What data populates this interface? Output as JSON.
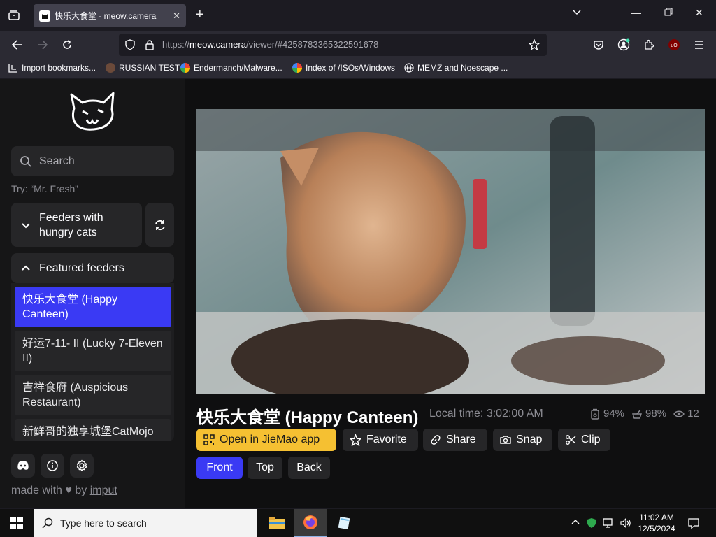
{
  "browser": {
    "tab_title": "快乐大食堂 - meow.camera",
    "url_domain": "meow.camera",
    "url_prefix": "https://",
    "url_path": "/viewer/#4258783365322591678",
    "bookmarks": [
      "Import bookmarks...",
      "RUSSIAN TEST",
      "Endermanch/Malware...",
      "Index of /ISOs/Windows",
      "MEMZ and Noescape ..."
    ]
  },
  "sidebar": {
    "search_placeholder": "Search",
    "try_hint": "Try: “Mr. Fresh”",
    "hungry_label": "Feeders with hungry cats",
    "featured_label": "Featured feeders",
    "feeders": [
      "快乐大食堂 (Happy Canteen)",
      "好运7-11- II (Lucky 7-Eleven II)",
      "吉祥食府 (Auspicious Restaurant)",
      "新鲜哥的独享城堡CatMojo"
    ],
    "made_with": "made with",
    "by": "by",
    "author": "imput"
  },
  "viewer": {
    "title": "快乐大食堂 (Happy Canteen)",
    "local_time": "Local time: 3:02:00 AM",
    "food_level": "94%",
    "battery": "98%",
    "viewers": "12",
    "buttons": {
      "open_app": "Open in JieMao app",
      "favorite": "Favorite",
      "share": "Share",
      "snap": "Snap",
      "clip": "Clip"
    },
    "cameras": [
      "Front",
      "Top",
      "Back"
    ]
  },
  "taskbar": {
    "search_placeholder": "Type here to search",
    "time": "11:02 AM",
    "date": "12/5/2024"
  },
  "colors": {
    "accent": "#3a3af4",
    "app_button": "#f5c032"
  }
}
